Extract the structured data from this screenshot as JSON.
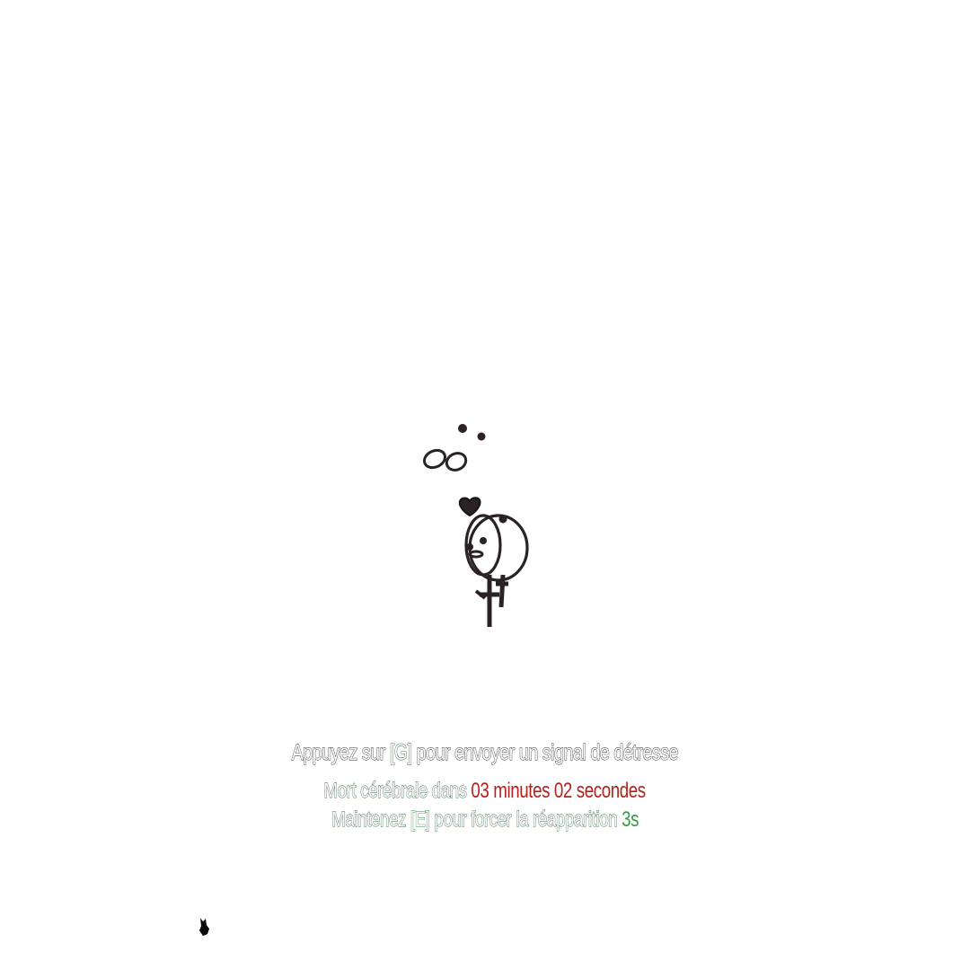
{
  "hud": {
    "distress": {
      "prefix": "Appuyez sur",
      "key": "[G]",
      "suffix": "pour envoyer un signal de détresse"
    },
    "brain_death": {
      "prefix": "Mort cérébrale dans",
      "timer": "03 minutes 02 secondes"
    },
    "respawn": {
      "prefix": "Maintenez",
      "key": "[E]",
      "middle": "pour forcer la réapparition",
      "seconds": "3s"
    }
  },
  "colors": {
    "key_green": "#2e8b3e",
    "timer_red": "#b3221c",
    "seconds_green": "#3a9a45"
  },
  "icons": {
    "dropped_items": "jewelry-pile-icon",
    "cursor": "cursor-icon"
  }
}
